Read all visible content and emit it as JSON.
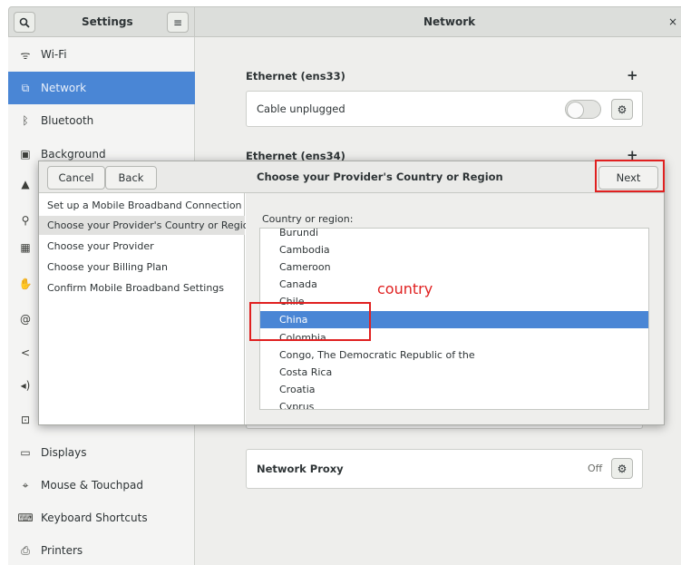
{
  "header": {
    "search_icon": "search-icon",
    "settings_title": "Settings",
    "menu_icon": "hamburger-menu-icon",
    "panel_title": "Network",
    "close_label": "×"
  },
  "sidebar": {
    "items": [
      {
        "label": "Wi-Fi",
        "icon": "wifi-icon"
      },
      {
        "label": "Network",
        "icon": "network-icon"
      },
      {
        "label": "Bluetooth",
        "icon": "bluetooth-icon"
      },
      {
        "label": "Background",
        "icon": "background-icon"
      },
      {
        "label": "",
        "icon": "notifications-icon"
      },
      {
        "label": "",
        "icon": "search-icon"
      },
      {
        "label": "",
        "icon": "applications-icon"
      },
      {
        "label": "",
        "icon": "privacy-icon"
      },
      {
        "label": "",
        "icon": "online-accounts-icon"
      },
      {
        "label": "",
        "icon": "sharing-icon"
      },
      {
        "label": "",
        "icon": "sound-icon"
      },
      {
        "label": "",
        "icon": "power-icon"
      },
      {
        "label": "Displays",
        "icon": "display-icon"
      },
      {
        "label": "Mouse & Touchpad",
        "icon": "mouse-icon"
      },
      {
        "label": "Keyboard Shortcuts",
        "icon": "keyboard-icon"
      },
      {
        "label": "Printers",
        "icon": "printer-icon"
      }
    ]
  },
  "main": {
    "ethernet1_title": "Ethernet (ens33)",
    "ethernet1_status": "Cable unplugged",
    "ethernet2_title": "Ethernet (ens34)",
    "plus": "+",
    "proxy_label": "Network Proxy",
    "proxy_status": "Off"
  },
  "dialog": {
    "cancel_label": "Cancel",
    "back_label": "Back",
    "title": "Choose your Provider's Country or Region",
    "next_label": "Next",
    "steps": [
      "Set up a Mobile Broadband Connection",
      "Choose your Provider's Country or Region",
      "Choose your Provider",
      "Choose your Billing Plan",
      "Confirm Mobile Broadband Settings"
    ],
    "current_step": 1,
    "country_label": "Country or region:",
    "countries": [
      "Burundi",
      "Cambodia",
      "Cameroon",
      "Canada",
      "Chile",
      "China",
      "Colombia",
      "Congo, The Democratic Republic of the",
      "Costa Rica",
      "Croatia",
      "Cyprus"
    ],
    "selected_country": "China"
  },
  "annotation": {
    "label": "country",
    "color": "#e02020"
  },
  "colors": {
    "accent": "#4a86d5",
    "header_bg": "#dcdedb",
    "panel_bg": "#eeeeec"
  }
}
